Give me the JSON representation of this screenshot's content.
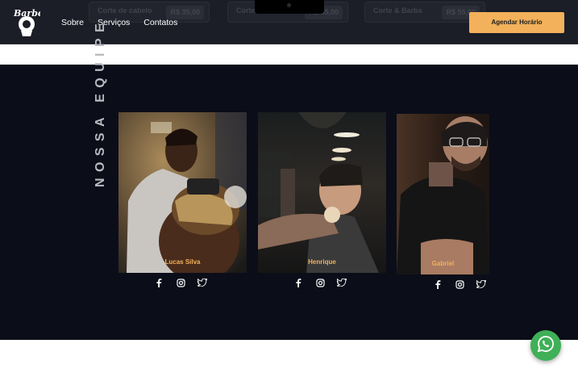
{
  "header": {
    "logo_text": "Barber",
    "nav": [
      "Sobre",
      "Serviços",
      "Contatos"
    ],
    "cta_label": "Agendar Horário",
    "price_strip": [
      {
        "name": "Corte de cabelo",
        "price": "R$ 35,00"
      },
      {
        "name": "Corte",
        "price": "R$ 35,00"
      },
      {
        "name": "Corte & Barba",
        "price": "R$ 55,00"
      }
    ]
  },
  "team": {
    "title": "NOSSA EQUIPE",
    "members": [
      {
        "name": "Lucas Silva",
        "socials": [
          "facebook-icon",
          "instagram-icon",
          "twitter-icon"
        ]
      },
      {
        "name": "Henrique",
        "socials": [
          "facebook-icon",
          "instagram-icon",
          "twitter-icon"
        ]
      },
      {
        "name": "Gabriel",
        "socials": [
          "facebook-icon",
          "instagram-icon",
          "twitter-icon"
        ]
      }
    ]
  },
  "floating": {
    "whatsapp_icon": "whatsapp-icon"
  },
  "colors": {
    "accent": "#f2b15a",
    "background": "#0b0d19",
    "header": "#1b1d27",
    "whatsapp": "#3fb057"
  }
}
